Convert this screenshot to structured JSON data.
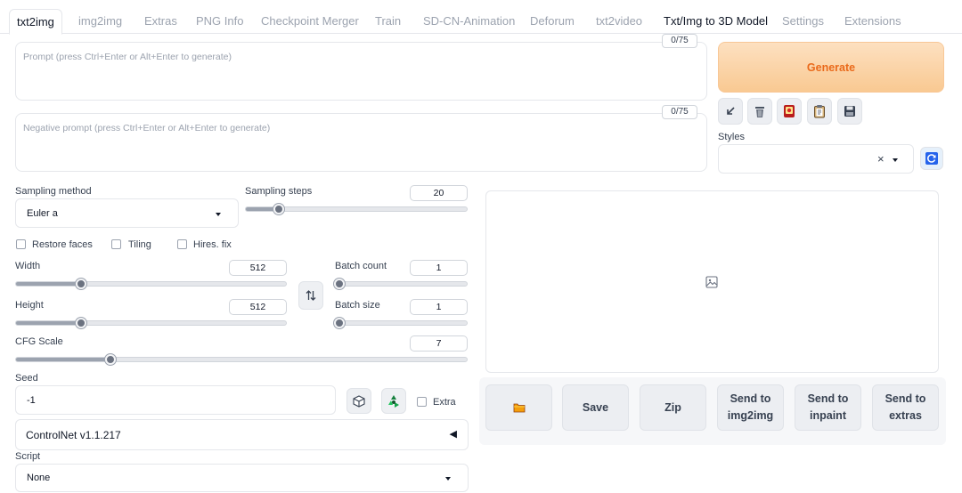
{
  "tabs": [
    {
      "label": "txt2img",
      "active": true
    },
    {
      "label": "img2img"
    },
    {
      "label": "Extras"
    },
    {
      "label": "PNG Info"
    },
    {
      "label": "Checkpoint Merger"
    },
    {
      "label": "Train"
    },
    {
      "label": "SD-CN-Animation"
    },
    {
      "label": "Deforum"
    },
    {
      "label": "txt2video"
    },
    {
      "label": "Txt/Img to 3D Model"
    },
    {
      "label": "Settings"
    },
    {
      "label": "Extensions"
    }
  ],
  "prompt": {
    "placeholder": "Prompt (press Ctrl+Enter or Alt+Enter to generate)",
    "counter": "0/75"
  },
  "negative_prompt": {
    "placeholder": "Negative prompt (press Ctrl+Enter or Alt+Enter to generate)",
    "counter": "0/75"
  },
  "generate_label": "Generate",
  "tool_icons": [
    "arrow-icon",
    "trash-icon",
    "card-icon",
    "clipboard-icon",
    "save-icon"
  ],
  "styles": {
    "label": "Styles",
    "clear_glyph": "×"
  },
  "sampling_method": {
    "label": "Sampling method",
    "value": "Euler a"
  },
  "sampling_steps": {
    "label": "Sampling steps",
    "value": "20",
    "fraction": 0.15
  },
  "checkboxes": {
    "restore_faces": "Restore faces",
    "tiling": "Tiling",
    "hires_fix": "Hires. fix"
  },
  "width": {
    "label": "Width",
    "value": "512",
    "fraction": 0.24
  },
  "height": {
    "label": "Height",
    "value": "512",
    "fraction": 0.24
  },
  "batch_count": {
    "label": "Batch count",
    "value": "1",
    "fraction": 0.0
  },
  "batch_size": {
    "label": "Batch size",
    "value": "1",
    "fraction": 0.0
  },
  "cfg_scale": {
    "label": "CFG Scale",
    "value": "7",
    "fraction": 0.21
  },
  "seed": {
    "label": "Seed",
    "value": "-1",
    "extra_label": "Extra"
  },
  "controlnet": {
    "label": "ControlNet v1.1.217",
    "arrow": "◀"
  },
  "script": {
    "label": "Script",
    "value": "None"
  },
  "actions": {
    "folder_icon": "folder-icon",
    "save": "Save",
    "zip": "Zip",
    "send_img2img": "Send to img2img",
    "send_inpaint": "Send to inpaint",
    "send_extras": "Send to extras"
  },
  "colors": {
    "generate_text": "#ea6a1b",
    "generate_bg": "#f9c992",
    "refresh_icon": "#2563eb"
  }
}
